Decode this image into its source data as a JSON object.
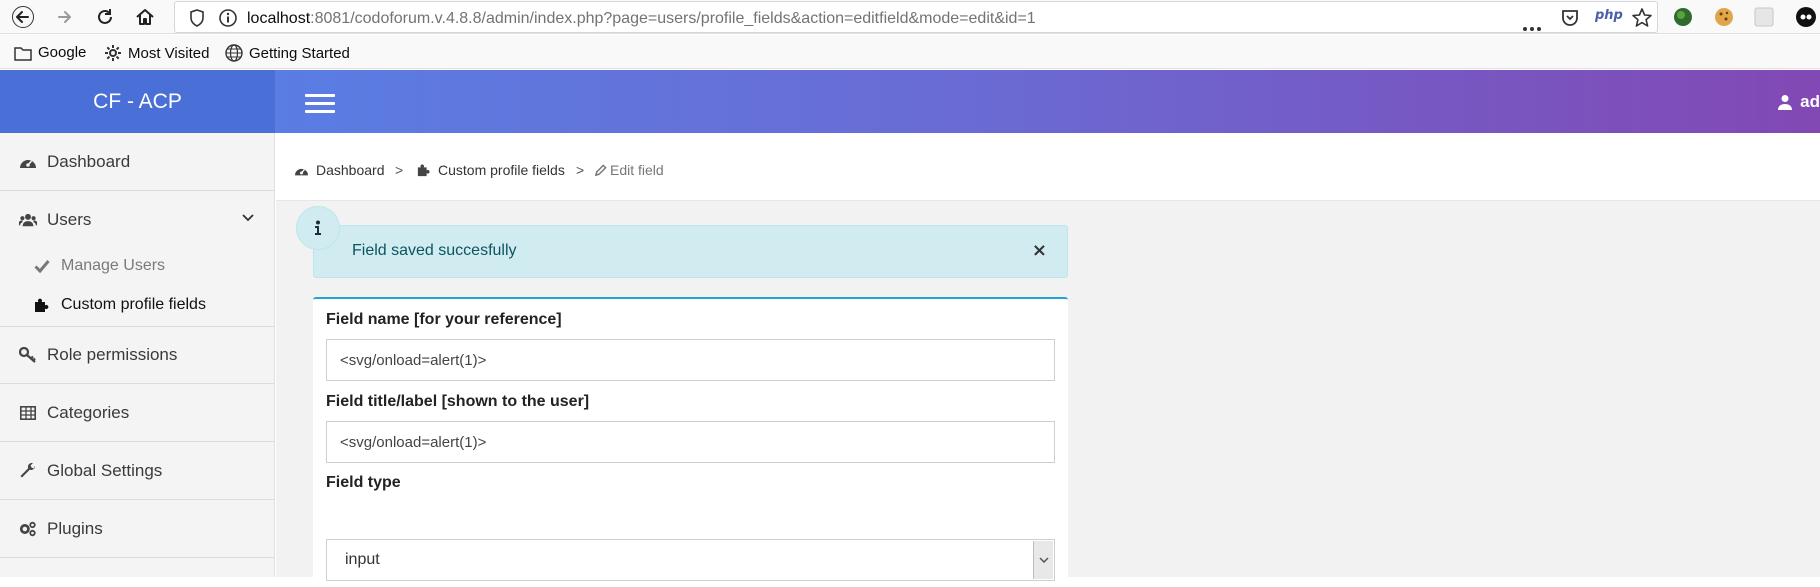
{
  "browser": {
    "url_host": "localhost",
    "url_rest": ":8081/codoforum.v.4.8.8/admin/index.php?page=users/profile_fields&action=editfield&mode=edit&id=1",
    "bookmarks": [
      "Google",
      "Most Visited",
      "Getting Started"
    ],
    "ext_label": "php"
  },
  "header": {
    "brand": "CF - ACP",
    "user": "ad"
  },
  "sidebar": {
    "items": [
      {
        "label": "Dashboard",
        "icon": "dashboard-icon"
      },
      {
        "label": "Users",
        "icon": "users-icon"
      },
      {
        "label": "Role permissions",
        "icon": "key-icon"
      },
      {
        "label": "Categories",
        "icon": "table-icon"
      },
      {
        "label": "Global Settings",
        "icon": "wrench-icon"
      },
      {
        "label": "Plugins",
        "icon": "gears-icon"
      }
    ],
    "sub_items": [
      {
        "label": "Manage Users",
        "icon": "check-icon"
      },
      {
        "label": "Custom profile fields",
        "icon": "puzzle-icon"
      }
    ]
  },
  "breadcrumb": {
    "items": [
      "Dashboard",
      "Custom profile fields",
      "Edit field"
    ],
    "separator": ">"
  },
  "alert": {
    "message": "Field saved succesfully",
    "close": "×"
  },
  "form": {
    "field_name_label": "Field name [for your reference]",
    "field_name_value": "<svg/onload=alert(1)>",
    "field_title_label": "Field title/label [shown to the user]",
    "field_title_value": "<svg/onload=alert(1)>",
    "field_type_label": "Field type",
    "field_type_value": "input"
  },
  "colors": {
    "brand_bg": "#4a6fd6",
    "topbar_start": "#5a7de3",
    "topbar_end": "#8248b4",
    "alert_bg": "#d1ecf1",
    "card_border": "#23a3d9"
  }
}
